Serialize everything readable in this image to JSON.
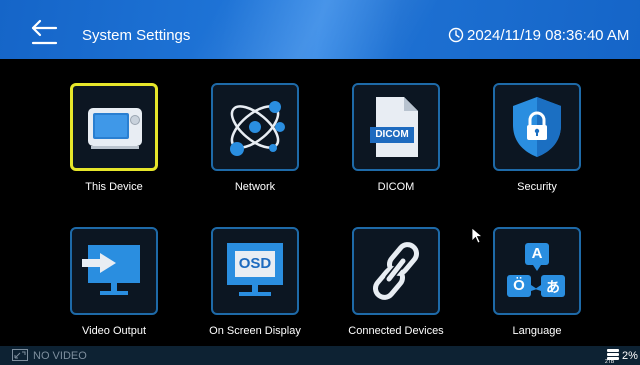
{
  "header": {
    "title": "System Settings",
    "datetime": "2024/11/19 08:36:40 AM"
  },
  "tiles": [
    {
      "label": "This Device",
      "icon": "device-icon",
      "selected": true
    },
    {
      "label": "Network",
      "icon": "network-icon"
    },
    {
      "label": "DICOM",
      "icon": "dicom-file-icon",
      "badge": "DICOM"
    },
    {
      "label": "Security",
      "icon": "shield-lock-icon"
    },
    {
      "label": "Video Output",
      "icon": "video-output-icon"
    },
    {
      "label": "On Screen Display",
      "icon": "osd-monitor-icon",
      "badge": "OSD"
    },
    {
      "label": "Connected Devices",
      "icon": "link-icon"
    },
    {
      "label": "Language",
      "icon": "language-icon",
      "glyphs": [
        "A",
        "Ö",
        "あ"
      ]
    }
  ],
  "status": {
    "video": "NO VIDEO",
    "disk_percent": "2%",
    "disk_label": "2TB"
  },
  "colors": {
    "header": "#1e73d6",
    "tile_border": "#1e6aa8",
    "selected_border": "#e6e62a",
    "icon_blue": "#2a8ee0"
  }
}
